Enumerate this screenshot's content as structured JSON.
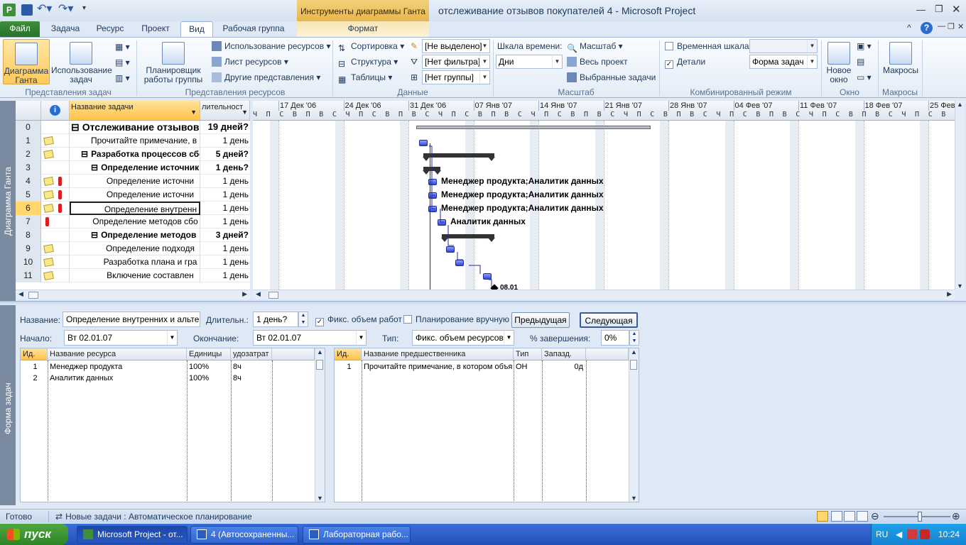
{
  "window": {
    "title": "отслеживание отзывов покупателей 4 - Microsoft Project",
    "context_header": "Инструменты диаграммы Ганта"
  },
  "tabs": [
    "Файл",
    "Задача",
    "Ресурс",
    "Проект",
    "Вид",
    "Рабочая группа",
    "Формат"
  ],
  "active_tab": "Вид",
  "ribbon": {
    "task_views": {
      "gantt": "Диаграмма Ганта",
      "usage": "Использование задач",
      "label": "Представления задач"
    },
    "resource_views": {
      "planner": "Планировщик работы группы",
      "res_usage": "Использование ресурсов",
      "res_sheet": "Лист ресурсов",
      "other": "Другие представления",
      "label": "Представления ресурсов"
    },
    "data": {
      "sort": "Сортировка",
      "outline": "Структура",
      "tables": "Таблицы",
      "highlight": "[Не выделено]",
      "filter": "[Нет фильтра]",
      "group": "[Нет группы]",
      "label": "Данные"
    },
    "zoom": {
      "timescale_label": "Шкала времени:",
      "timescale_value": "Дни",
      "zoom": "Масштаб",
      "entire": "Весь проект",
      "selected": "Выбранные задачи",
      "label": "Масштаб"
    },
    "split": {
      "timeline": "Временная шкала",
      "details": "Детали",
      "details_checked": true,
      "timeline_checked": false,
      "form": "Форма задач",
      "label": "Комбинированный режим"
    },
    "window": {
      "new": "Новое окно",
      "label": "Окно"
    },
    "macros": {
      "macros": "Макросы",
      "label": "Макросы"
    }
  },
  "side_labels": {
    "top": "Диаграмма Ганта",
    "bottom": "Форма задач"
  },
  "grid": {
    "headers": {
      "name": "Название задачи",
      "duration": "лительност"
    },
    "rows": [
      {
        "id": "0",
        "name": "Отслеживание отзывов п",
        "dur": "19 дней?",
        "level": 0,
        "bold": true,
        "collapse": true,
        "big": true,
        "note": false,
        "res": false
      },
      {
        "id": "1",
        "name": "Прочитайте примечание, в кс",
        "dur": "1 день",
        "level": 2,
        "bold": false,
        "collapse": false,
        "note": true,
        "res": false
      },
      {
        "id": "2",
        "name": "Разработка процессов сбо",
        "dur": "5 дней?",
        "level": 1,
        "bold": true,
        "collapse": true,
        "note": true,
        "res": false
      },
      {
        "id": "3",
        "name": "Определение источник",
        "dur": "1 день?",
        "level": 2,
        "bold": true,
        "collapse": true,
        "note": false,
        "res": false
      },
      {
        "id": "4",
        "name": "Определение источни",
        "dur": "1 день",
        "level": 3,
        "bold": false,
        "collapse": false,
        "note": true,
        "res": true
      },
      {
        "id": "5",
        "name": "Определение источни",
        "dur": "1 день",
        "level": 3,
        "bold": false,
        "collapse": false,
        "note": true,
        "res": true
      },
      {
        "id": "6",
        "name": "Определение внутренн",
        "dur": "1 день",
        "level": 3,
        "bold": false,
        "collapse": false,
        "note": true,
        "res": true,
        "selected": true
      },
      {
        "id": "7",
        "name": "Определение методов сбо",
        "dur": "1 день",
        "level": 2,
        "bold": false,
        "collapse": false,
        "note": false,
        "res": true
      },
      {
        "id": "8",
        "name": "Определение методов",
        "dur": "3 дней?",
        "level": 2,
        "bold": true,
        "collapse": true,
        "note": false,
        "res": false
      },
      {
        "id": "9",
        "name": "Определение подходя",
        "dur": "1 день",
        "level": 3,
        "bold": false,
        "collapse": false,
        "note": true,
        "res": false
      },
      {
        "id": "10",
        "name": "Разработка плана и гра",
        "dur": "1 день",
        "level": 3,
        "bold": false,
        "collapse": false,
        "note": true,
        "res": false
      },
      {
        "id": "11",
        "name": "Включение составлен",
        "dur": "1 день",
        "level": 3,
        "bold": false,
        "collapse": false,
        "note": true,
        "res": false
      }
    ]
  },
  "timeline": {
    "weeks": [
      "17 Дек '06",
      "24 Дек '06",
      "31 Дек '06",
      "07 Янв '07",
      "14 Янв '07",
      "21 Янв '07",
      "28 Янв '07",
      "04 Фев '07",
      "11 Фев '07",
      "18 Фев '07",
      "25 Фев"
    ],
    "days": "Ч П С В П В С Ч П С В П В С Ч П С В П В С Ч П С В П В С Ч П С В П В С Ч П С В П В С Ч П С В П В С Ч П С В П В С Ч П С В П В С Ч П С В П В С Ч П С В П В С Ч П С В П В С Ч П С В П В С Ч П С В П В С",
    "bar_labels": [
      "Менеджер продукта;Аналитик данных",
      "Менеджер продукта;Аналитик данных",
      "Менеджер продукта;Аналитик данных",
      "Аналитик данных",
      "08.01"
    ]
  },
  "form": {
    "name_label": "Название:",
    "name_value": "Определение внутренних и альтерн",
    "duration_label": "Длительн.:",
    "duration_value": "1 день?",
    "fixed_work_label": "Фикс. объем работ",
    "fixed_work_checked": true,
    "manual_label": "Планирование вручную",
    "manual_checked": false,
    "prev": "Предыдущая",
    "next": "Следующая",
    "start_label": "Начало:",
    "start_value": "Вт 02.01.07",
    "finish_label": "Окончание:",
    "finish_value": "Вт 02.01.07",
    "type_label": "Тип:",
    "type_value": "Фикс. объем ресурсов",
    "complete_label": "% завершения:",
    "complete_value": "0%",
    "res_headers": [
      "Ид.",
      "Название ресурса",
      "Единицы",
      "удозатрат"
    ],
    "resources": [
      {
        "id": "1",
        "name": "Менеджер продукта",
        "units": "100%",
        "work": "8ч"
      },
      {
        "id": "2",
        "name": "Аналитик данных",
        "units": "100%",
        "work": "8ч"
      }
    ],
    "pred_headers": [
      "Ид.",
      "Название предшественника",
      "Тип",
      "Запазд."
    ],
    "predecessors": [
      {
        "id": "1",
        "name": "Прочитайте примечание, в котором объя",
        "type": "ОН",
        "lag": "0д"
      }
    ]
  },
  "status": {
    "ready": "Готово",
    "new_tasks": "Новые задачи : Автоматическое планирование"
  },
  "taskbar": {
    "start": "пуск",
    "items": [
      "Microsoft Project - от...",
      "4 (Автосохраненны...",
      "Лабораторная рабо..."
    ],
    "lang": "RU",
    "time": "10:24"
  }
}
